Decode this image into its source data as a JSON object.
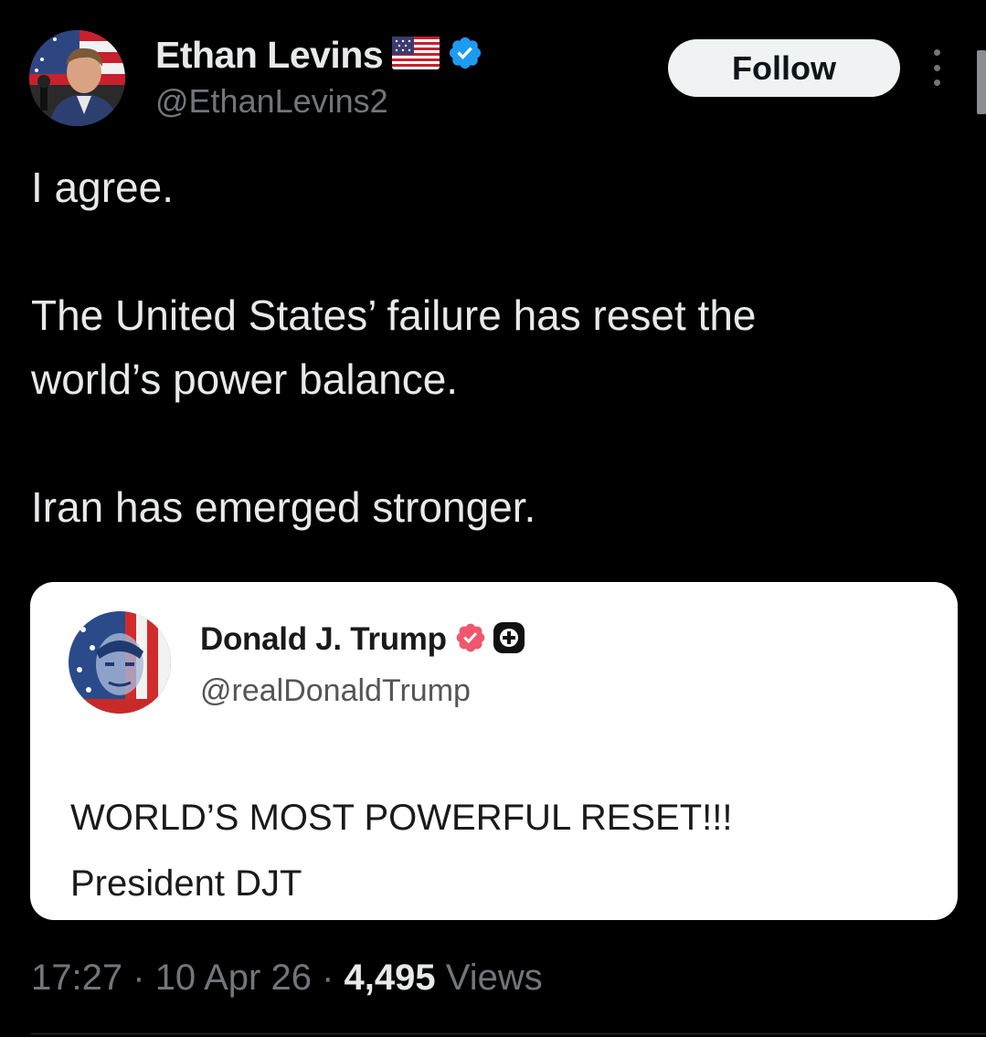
{
  "author": {
    "display_name": "Ethan Levins",
    "handle": "@EthanLevins2",
    "flag_icon": "us-flag-icon",
    "verified_icon": "verified-badge-icon",
    "verified_color": "#1d9bf0"
  },
  "follow_button": {
    "label": "Follow"
  },
  "more_icon": "more-vertical-icon",
  "tweet": {
    "paragraphs": [
      "I agree.",
      "The United States’ failure has reset the",
      "world’s power balance.",
      "Iran has emerged stronger."
    ]
  },
  "quoted_post": {
    "display_name": "Donald J. Trump",
    "handle": "@realDonaldTrump",
    "badge_icon": "verified-badge-icon",
    "badge_color": "#f0566e",
    "plus_icon": "plus-icon",
    "text_lines": [
      "WORLD’S MOST POWERFUL RESET!!!",
      "President DJT"
    ]
  },
  "meta": {
    "time": "17:27",
    "date": "10 Apr 26",
    "separator": "·",
    "views_count": "4,495",
    "views_label": "Views"
  },
  "colors": {
    "background": "#000000",
    "text_primary": "#e7e9ea",
    "text_secondary": "#71767b",
    "follow_bg": "#eff3f4"
  }
}
